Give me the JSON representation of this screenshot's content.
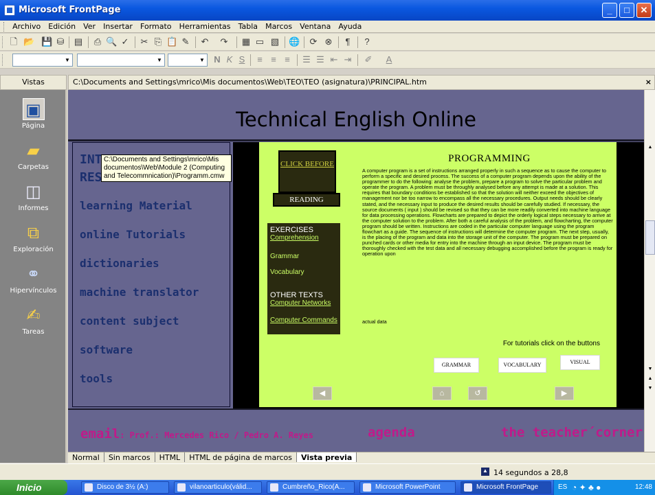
{
  "window": {
    "title": "Microsoft FrontPage"
  },
  "menu": [
    "Archivo",
    "Edición",
    "Ver",
    "Insertar",
    "Formato",
    "Herramientas",
    "Tabla",
    "Marcos",
    "Ventana",
    "Ayuda"
  ],
  "vistas": {
    "header": "Vistas",
    "items": [
      {
        "label": "Página",
        "icon": "page-icon"
      },
      {
        "label": "Carpetas",
        "icon": "folder-icon"
      },
      {
        "label": "Informes",
        "icon": "reports-icon"
      },
      {
        "label": "Exploración",
        "icon": "navigation-icon"
      },
      {
        "label": "Hipervínculos",
        "icon": "hyperlinks-icon"
      },
      {
        "label": "Tareas",
        "icon": "tasks-icon"
      }
    ]
  },
  "path": "C:\\Documents and Settings\\mrico\\Mis documentos\\Web\\TEO\\TEO (asignatura)\\PRINCIPAL.htm",
  "site": {
    "title": "Technical English Online",
    "nav": [
      "INT",
      "RES",
      "learning Material",
      "online Tutorials",
      "dictionaries",
      "machine translator",
      "content subject",
      "software",
      "tools"
    ],
    "tooltip": "C:\\Documents and Settings\\mrico\\Mis documentos\\Web\\Module 2 (Computing and Telecommnication)\\Programm.cmw",
    "click_before": "CLICK BEFORE",
    "reading": "READING",
    "exercises_title": "EXERCISES",
    "exercises": [
      "Comprehension",
      "Grammar",
      "Vocabulary"
    ],
    "other_title": "OTHER TEXTS",
    "other": [
      "Computer Networks",
      "Computer Commands"
    ],
    "programming_title": "PROGRAMMING",
    "programming_text": "A computer program is a set of instructions arranged properly in such a sequence as to cause the computer to perform a specific and desired process. The success of a computer program depends upon the ability of the programmer to do the following: analyse the problem, prepare a program to solve the particular problem and operate the program. A problem must be throughly analysed before any attempt is made at a solution. This requires that boundary conditions be established so that the solution will neither exceed the objectives of management nor be too narrow to encompass all the necessary procedures. Output needs should be clearly stated, and the necessary input to produce the desired results should be carefully studied. If necessary, the source documents ( input ) should be revised so that they can be more readily converted into machine language for data processing operations. Flowcharts are prepared to depict the orderly logical steps necessary to arrive at the computer solution to the problem. After both a careful analysis of the problem, and flowcharting, the computer program should be written. Instructions are coded in the particular computer language using the program flowchart as a guide. The sequence of instructions will determine the computer program. The next step, usually, is the placing of the program and data into the storage unit of the computer. The program must be prepared on punched cards or other media for entry into the machine through an input device. The program must be thoroughly checked with the test data and all necessary debugging accomplished before the program is ready for operation upon",
    "actual_data": "actual data",
    "tutorials_label": "For tutorials click on the buttons",
    "buttons": [
      "GRAMMAR",
      "VOCABULARY",
      "VISUAL"
    ],
    "footer_email": "email",
    "footer_profs": ": Prof.: Mercedes Rico / Pedro A. Reyes",
    "footer_agenda": "agenda",
    "footer_teacher": "the teacher´corner"
  },
  "tabs": [
    "Normal",
    "Sin marcos",
    "HTML",
    "HTML de página de marcos",
    "Vista previa"
  ],
  "status": {
    "time": "14 segundos a 28,8"
  },
  "taskbar": {
    "start": "Inicio",
    "tasks": [
      "Disco de 3½ (A:)",
      "vilanoarticulo(válid...",
      "Cumbreño_Rico(A...",
      "Microsoft PowerPoint",
      "Microsoft FrontPage"
    ],
    "lang": "ES",
    "clock": "12:48"
  }
}
